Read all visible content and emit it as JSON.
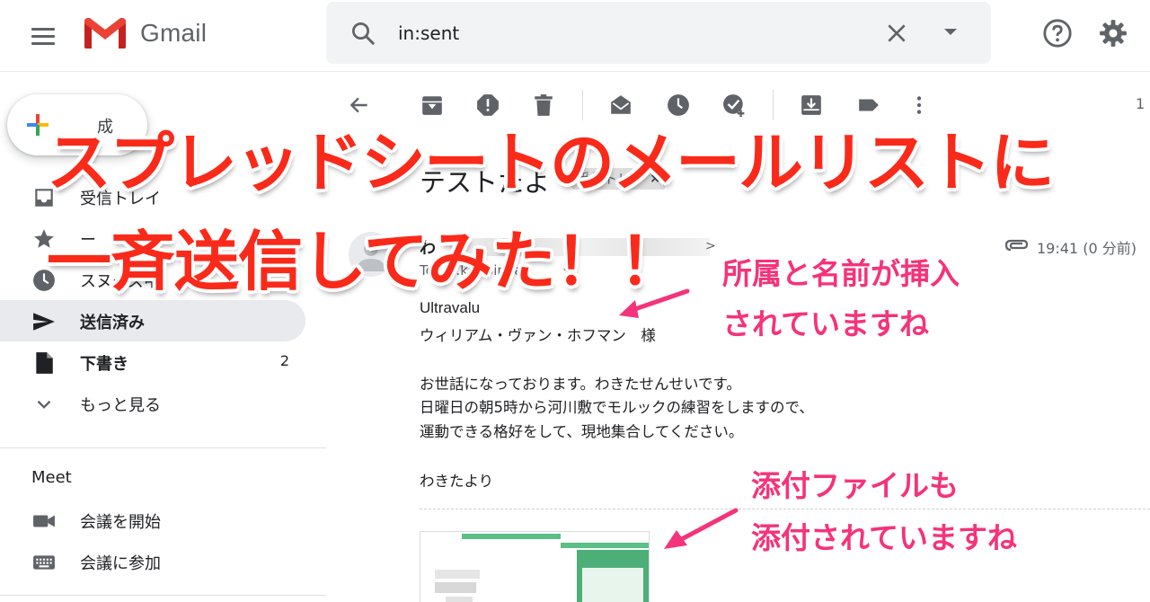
{
  "header": {
    "app_name": "Gmail",
    "search": {
      "value": "in:sent"
    }
  },
  "sidebar": {
    "compose_label": "成",
    "items": [
      {
        "label": "受信トレイ",
        "icon": "inbox-icon",
        "count": ""
      },
      {
        "label": "ー",
        "icon": "star-icon",
        "count": ""
      },
      {
        "label": "スヌーズ中",
        "icon": "clock-icon",
        "count": ""
      },
      {
        "label": "送信済み",
        "icon": "send-icon",
        "count": "",
        "active": true
      },
      {
        "label": "下書き",
        "icon": "draft-icon",
        "count": "2"
      },
      {
        "label": "もっと見る",
        "icon": "chevron-down-icon",
        "count": ""
      }
    ],
    "meet": {
      "title": "Meet",
      "items": [
        {
          "label": "会議を開始",
          "icon": "videocam-icon"
        },
        {
          "label": "会議に参加",
          "icon": "keyboard-icon"
        }
      ]
    }
  },
  "toolbar": {
    "page_count": "1"
  },
  "email": {
    "subject": "テストたよ",
    "label_chip": "受信トレイ",
    "sender_initial": "わ",
    "sender_suffix": ">",
    "to_line": "To tar.kioroinha",
    "time": "19:41 (0 分前)",
    "body": {
      "company": "Ultravalu",
      "recipient": "ウィリアム・ヴァン・ホフマン　様",
      "line1": "お世話になっております。わきたせんせいです。",
      "line2": "日曜日の朝5時から河川敷でモルックの練習をしますので、",
      "line3": "運動できる格好をして、現地集合してください。",
      "signature": "わきたより"
    }
  },
  "overlay": {
    "headline_line1": "スプレッドシートのメールリストに",
    "headline_line2": "一斉送信してみた！！",
    "note1_line1": "所属と名前が挿入",
    "note1_line2": "されていますね",
    "note2_line1": "添付ファイルも",
    "note2_line2": "添付されていますね"
  },
  "colors": {
    "headline": "#fa2a1a",
    "note": "#f5337a",
    "active_nav": "#e8eaed",
    "search_bg": "#f1f3f4"
  }
}
